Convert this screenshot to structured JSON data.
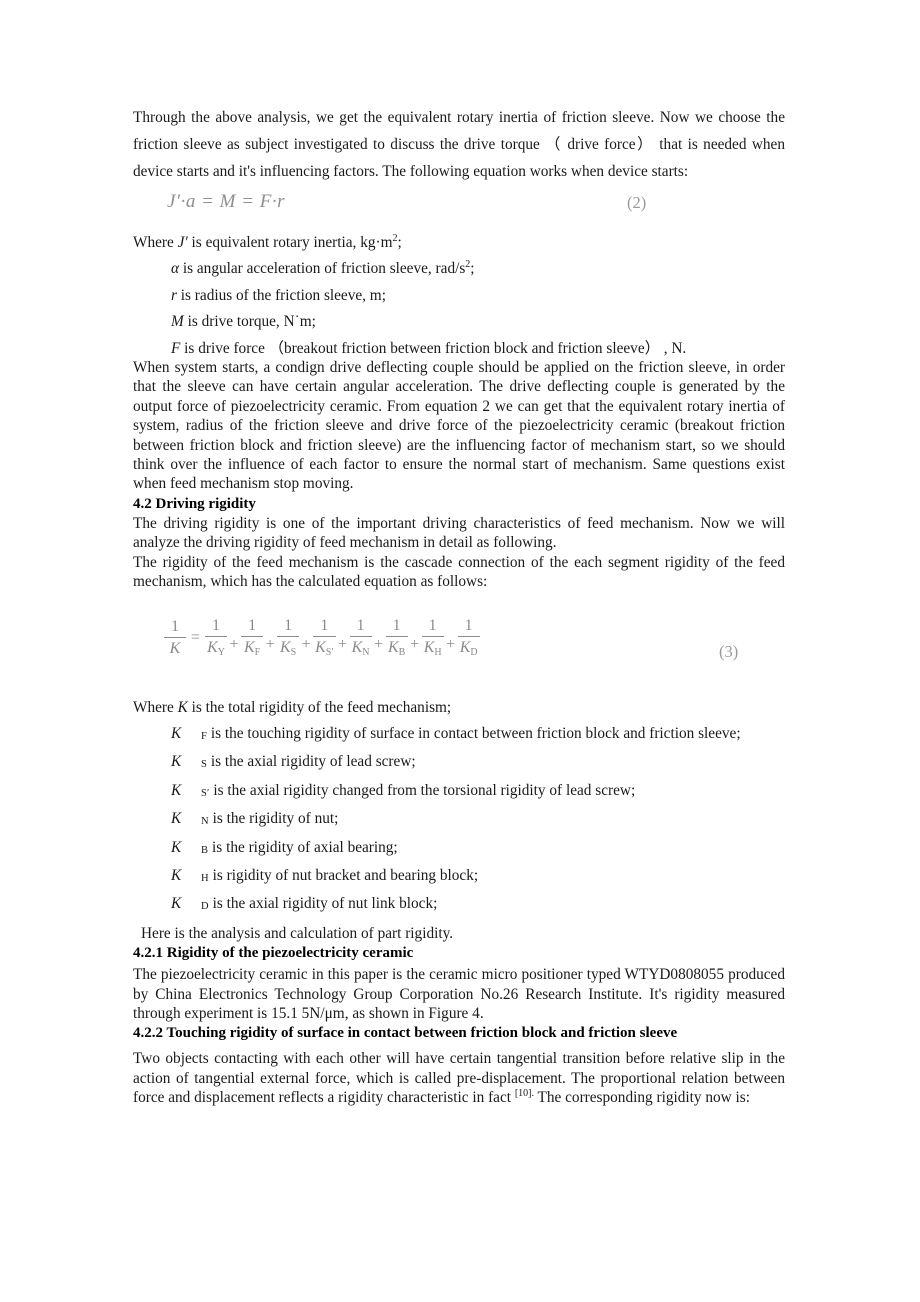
{
  "document": {
    "paragraphs": {
      "p1": "Through the above analysis, we get the equivalent rotary inertia of friction sleeve. Now we choose the friction sleeve as subject investigated to discuss the drive torque （ drive force） that is needed when device starts and it's influencing factors. The following equation works when device starts:",
      "p2": "When system starts, a condign drive deflecting couple should be applied on the friction sleeve, in order that the sleeve can have certain angular acceleration. The drive deflecting couple is generated by the output force of piezoelectricity ceramic. From equation 2 we can get that the equivalent rotary inertia of system, radius of the friction sleeve and drive force of the piezoelectricity ceramic (breakout friction between friction block and friction sleeve) are the influencing factor of mechanism start, so we should think over the influence of each factor to ensure the normal start of mechanism. Same questions exist when feed mechanism stop moving.",
      "p3": "The driving rigidity is one of the important driving characteristics of feed mechanism. Now we will analyze the driving rigidity of feed mechanism in detail as following.",
      "p4": "The rigidity of the feed mechanism is the cascade connection of the each segment rigidity of the feed mechanism, which has the calculated equation as follows:",
      "p5_before_cite": "Two objects contacting with each other will have certain tangential transition before relative slip in the action of tangential external force, which is called pre-displacement. The proportional relation between force and displacement reflects a rigidity characteristic in fact ",
      "p5_cite": "[10].",
      "p5_after_cite": " The corresponding rigidity now is:"
    },
    "equations": {
      "eq2_text": "J′·a = M = F·r",
      "eq2_number": "(2)",
      "eq3_number": "(3)",
      "eq3_lhs_num": "1",
      "eq3_lhs_den": "K",
      "eq3_equals": "=",
      "eq3_plus": "+",
      "eq3_terms": [
        {
          "num": "1",
          "den": "K",
          "sub": "Y"
        },
        {
          "num": "1",
          "den": "K",
          "sub": "F"
        },
        {
          "num": "1",
          "den": "K",
          "sub": "S"
        },
        {
          "num": "1",
          "den": "K",
          "sub": "S′"
        },
        {
          "num": "1",
          "den": "K",
          "sub": "N"
        },
        {
          "num": "1",
          "den": "K",
          "sub": "B"
        },
        {
          "num": "1",
          "den": "K",
          "sub": "H"
        },
        {
          "num": "1",
          "den": "K",
          "sub": "D"
        }
      ]
    },
    "definitions_eq2": {
      "where_lead": "Where ",
      "where_symbol": "J′",
      "where_rest": " is equivalent rotary inertia, kg·m",
      "where_sup": "2",
      "where_end": ";",
      "items": [
        {
          "symbol": "α",
          "text": " is angular acceleration of friction sleeve, rad/s",
          "sup": "2",
          "end": ";"
        },
        {
          "symbol": "r",
          "text": " is radius of the friction sleeve, m;",
          "sup": "",
          "end": ""
        },
        {
          "symbol": "M",
          "text": " is drive torque, N˙m;",
          "sup": "",
          "end": ""
        },
        {
          "symbol": "F",
          "text": " is drive force （breakout friction between friction block and friction sleeve） , N.",
          "sup": "",
          "end": ""
        }
      ]
    },
    "definitions_eq3": {
      "where_lead": "Where ",
      "where_symbol": "K",
      "where_rest": " is the total rigidity of the feed mechanism;",
      "items": [
        {
          "symbol": "K",
          "sub": "F",
          "text": "is the touching rigidity of surface in contact between friction block and friction sleeve;"
        },
        {
          "symbol": "K",
          "sub": "S",
          "text": "is the axial rigidity of lead screw;"
        },
        {
          "symbol": "K",
          "sub": "S′",
          "text": "is the axial rigidity changed from the torsional rigidity of lead screw;"
        },
        {
          "symbol": "K",
          "sub": "N",
          "text": "is the rigidity of nut;"
        },
        {
          "symbol": "K",
          "sub": "B",
          "text": "is the rigidity of axial bearing;"
        },
        {
          "symbol": "K",
          "sub": "H",
          "text": "is rigidity of nut bracket and bearing block;"
        },
        {
          "symbol": "K",
          "sub": "D",
          "text": "is the axial rigidity of nut link block;"
        }
      ],
      "closing": "Here is the analysis and calculation of part rigidity."
    },
    "headings": {
      "h42": "4.2 Driving rigidity",
      "h421": "4.2.1 Rigidity of the piezoelectricity ceramic",
      "h422": "4.2.2 Touching rigidity of surface in contact between friction block and friction sleeve"
    },
    "section_421_body": "The piezoelectricity ceramic in this paper is the ceramic micro positioner typed WTYD0808055 produced by China Electronics Technology Group Corporation No.26 Research Institute. It's rigidity measured through experiment is 15.1 5N/μm, as shown in Figure 4."
  }
}
